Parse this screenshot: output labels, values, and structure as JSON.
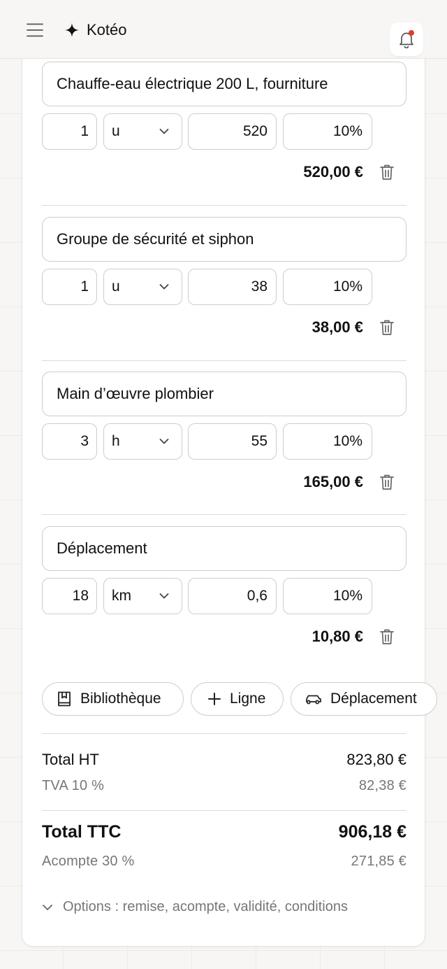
{
  "header": {
    "brand_name": "Kotéo"
  },
  "lines": [
    {
      "description": "Chauffe-eau électrique 200 L, fourniture",
      "quantity": "1",
      "unit": "u",
      "unit_price": "520",
      "vat_rate": "10",
      "vat_suffix": "%",
      "total": "520,00 €"
    },
    {
      "description": "Groupe de sécurité et siphon",
      "quantity": "1",
      "unit": "u",
      "unit_price": "38",
      "vat_rate": "10",
      "vat_suffix": "%",
      "total": "38,00 €"
    },
    {
      "description": "Main d’œuvre plombier",
      "quantity": "3",
      "unit": "h",
      "unit_price": "55",
      "vat_rate": "10",
      "vat_suffix": "%",
      "total": "165,00 €"
    },
    {
      "description": "Déplacement",
      "quantity": "18",
      "unit": "km",
      "unit_price": "0,6",
      "vat_rate": "10",
      "vat_suffix": "%",
      "total": "10,80 €"
    }
  ],
  "actions": {
    "library_label": "Bibliothèque",
    "add_line_label": "Ligne",
    "travel_label": "Déplacement"
  },
  "summary": {
    "total_ht_label": "Total HT",
    "total_ht_value": "823,80 €",
    "vat_label": "TVA 10 %",
    "vat_value": "82,38 €",
    "total_ttc_label": "Total TTC",
    "total_ttc_value": "906,18 €",
    "deposit_label": "Acompte 30 %",
    "deposit_value": "271,85 €"
  },
  "options": {
    "label": "Options : remise, acompte, validité, conditions"
  },
  "colors": {
    "notification_dot": "#e23a2f",
    "muted_text": "#777777",
    "border": "#cfcdc8"
  }
}
